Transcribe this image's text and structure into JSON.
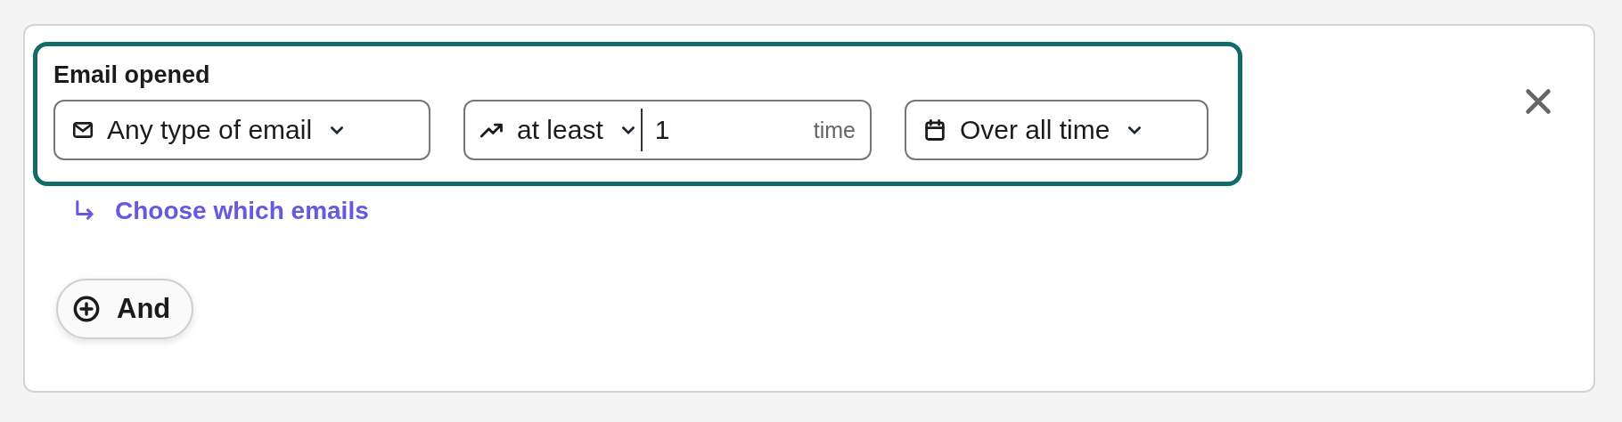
{
  "condition": {
    "title": "Email opened",
    "email_type": {
      "value": "Any type of email"
    },
    "frequency": {
      "operator": "at least",
      "count": "1",
      "unit": "time"
    },
    "date_range": {
      "value": "Over all time"
    }
  },
  "choose_link": "Choose which emails",
  "add_button": "And"
}
